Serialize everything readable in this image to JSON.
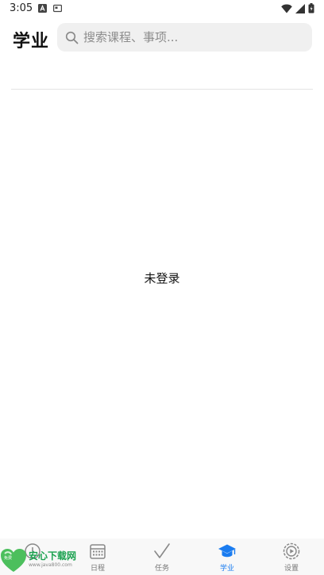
{
  "status_bar": {
    "time": "3:05"
  },
  "header": {
    "title": "学业",
    "search_placeholder": "搜索课程、事项..."
  },
  "main": {
    "empty_text": "未登录"
  },
  "tabbar": {
    "tabs": [
      {
        "label": "",
        "icon": "clock-icon",
        "active": false
      },
      {
        "label": "日程",
        "icon": "calendar-icon",
        "active": false
      },
      {
        "label": "任务",
        "icon": "checkmark-icon",
        "active": false
      },
      {
        "label": "学业",
        "icon": "graduation-cap-icon",
        "active": true
      },
      {
        "label": "设置",
        "icon": "gear-icon",
        "active": false
      }
    ],
    "active_color": "#1a7cf0",
    "inactive_color": "#777777"
  },
  "watermark": {
    "name": "安心下载网",
    "url": "www.java800.com",
    "badge": "免费"
  }
}
